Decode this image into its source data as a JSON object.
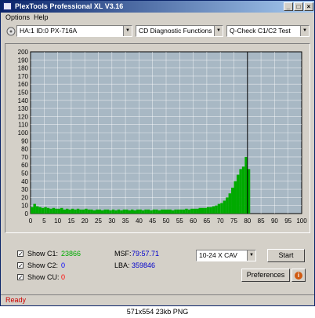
{
  "window": {
    "title": "PlexTools Professional XL V3.16",
    "controls": [
      "_",
      "□",
      "×"
    ]
  },
  "menu": {
    "items": [
      "Options",
      "Help"
    ]
  },
  "toolbar": {
    "drive": "HA:1 ID:0  PX-716A",
    "function": "CD Diagnostic Functions",
    "test": "Q-Check C1/C2 Test"
  },
  "chart_data": {
    "type": "area",
    "xlabel": "",
    "ylabel": "",
    "xlim": [
      0,
      100
    ],
    "ylim": [
      0,
      200
    ],
    "x_ticks": [
      0,
      5,
      10,
      15,
      20,
      25,
      30,
      35,
      40,
      45,
      50,
      55,
      60,
      65,
      70,
      75,
      80,
      85,
      90,
      95,
      100
    ],
    "y_ticks": [
      0,
      10,
      20,
      30,
      40,
      50,
      60,
      70,
      80,
      90,
      100,
      110,
      120,
      130,
      140,
      150,
      160,
      170,
      180,
      190,
      200
    ],
    "grid": true,
    "cursor_x": 80,
    "series": [
      {
        "color": "#00aa00",
        "x": [
          0,
          1,
          2,
          3,
          4,
          5,
          6,
          7,
          8,
          9,
          10,
          11,
          12,
          13,
          14,
          15,
          16,
          17,
          18,
          19,
          20,
          21,
          22,
          23,
          24,
          25,
          26,
          27,
          28,
          29,
          30,
          31,
          32,
          33,
          34,
          35,
          36,
          37,
          38,
          39,
          40,
          41,
          42,
          43,
          44,
          45,
          46,
          47,
          48,
          49,
          50,
          51,
          52,
          53,
          54,
          55,
          56,
          57,
          58,
          59,
          60,
          61,
          62,
          63,
          64,
          65,
          66,
          67,
          68,
          69,
          70,
          71,
          72,
          73,
          74,
          75,
          76,
          77,
          78,
          79,
          80
        ],
        "values": [
          8,
          12,
          9,
          8,
          7,
          8,
          7,
          6,
          7,
          6,
          6,
          7,
          5,
          6,
          5,
          6,
          5,
          6,
          5,
          5,
          6,
          5,
          5,
          4,
          5,
          5,
          4,
          5,
          5,
          4,
          5,
          4,
          5,
          4,
          5,
          5,
          4,
          5,
          4,
          5,
          5,
          4,
          5,
          5,
          4,
          5,
          5,
          4,
          5,
          5,
          5,
          5,
          4,
          5,
          5,
          5,
          5,
          6,
          5,
          6,
          6,
          6,
          7,
          7,
          7,
          8,
          8,
          9,
          10,
          12,
          13,
          16,
          20,
          25,
          32,
          40,
          48,
          55,
          58,
          70,
          55
        ]
      }
    ]
  },
  "stats": {
    "c1_label": "Show C1:",
    "c1_value": "23866",
    "c2_label": "Show C2:",
    "c2_value": "0",
    "cu_label": "Show CU:",
    "cu_value": "0",
    "msf_label": "MSF:",
    "msf_value": "79:57.71",
    "lba_label": "LBA:",
    "lba_value": "359846"
  },
  "colors": {
    "c1": "#00aa00",
    "c2": "#0000ff",
    "cu": "#ff0000",
    "msf": "#0000cc"
  },
  "speed": "10-24 X CAV",
  "buttons": {
    "start": "Start",
    "preferences": "Preferences",
    "info": "i"
  },
  "status": "Ready",
  "caption": "571x554  23kb  PNG"
}
